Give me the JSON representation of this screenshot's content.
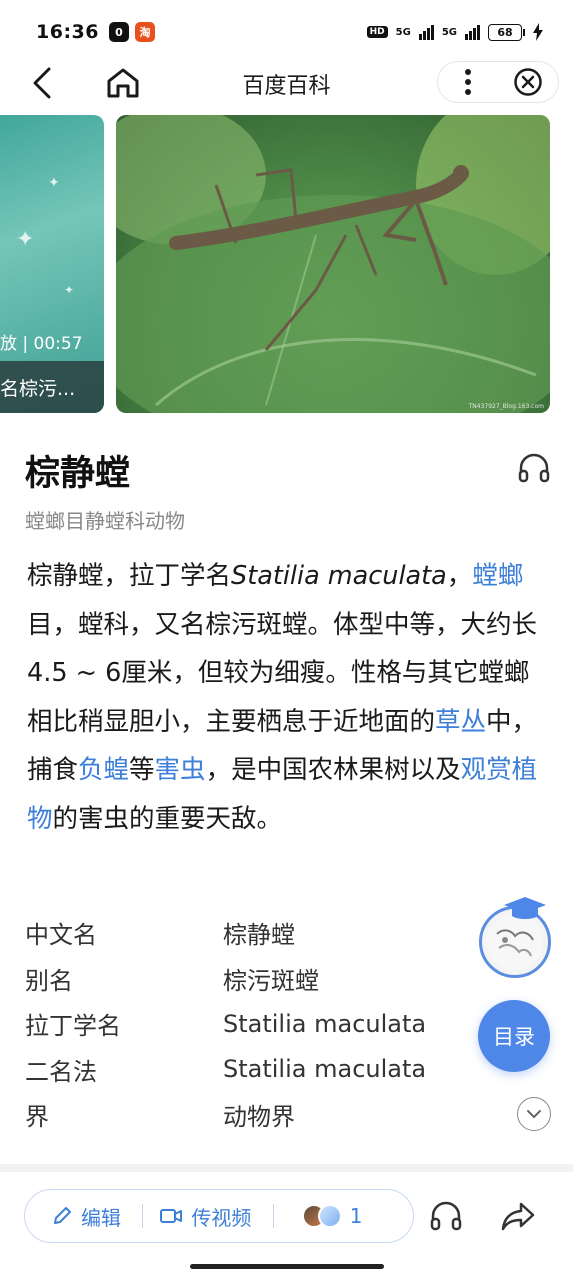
{
  "status_bar": {
    "time": "16:36",
    "app_badge_1": "0",
    "app_badge_2": "淘",
    "hd_label": "HD",
    "network_1": "5G",
    "network_2": "5G",
    "battery": "68"
  },
  "nav": {
    "title": "百度百科",
    "icons": [
      "back-icon",
      "home-icon",
      "more-icon",
      "close-icon"
    ]
  },
  "media": {
    "video_meta": "放 | 00:57",
    "video_caption": "名棕污...",
    "photo_watermark": "TN437927_Blog.163.com"
  },
  "entry": {
    "title": "棕静螳",
    "subtitle": "螳螂目静螳科动物"
  },
  "summary": {
    "t1": "棕静螳，拉丁学名",
    "latin": "Statilia maculata",
    "t2": "，",
    "link_mantis": "螳螂",
    "t3": "目，螳科，又名棕污斑螳。体型中等，大约长4.5 ~ 6厘米，但较为细瘦。性格与其它螳螂相比稍显胆小，主要栖息于近地面的",
    "link_grass": "草丛",
    "t4": "中，捕食",
    "link_locust": "负蝗",
    "t5": "等",
    "link_pest": "害虫",
    "t6": "，是中国农林果树以及",
    "link_plants": "观赏植物",
    "t7": "的害虫的重要天敌。"
  },
  "infobox": [
    {
      "label": "中文名",
      "value": "棕静螳"
    },
    {
      "label": "别名",
      "value": "棕污斑螳"
    },
    {
      "label": "拉丁学名",
      "value": "Statilia maculata"
    },
    {
      "label": "二名法",
      "value": "Statilia maculata"
    },
    {
      "label": "界",
      "value": "动物界"
    }
  ],
  "floating": {
    "toc_label": "目录"
  },
  "toolbar": {
    "edit_label": "编辑",
    "video_label": "传视频",
    "contributors_count": "1"
  },
  "colors": {
    "link": "#3d7fd9",
    "accent": "#4f87e8",
    "subtitle": "#888888"
  }
}
